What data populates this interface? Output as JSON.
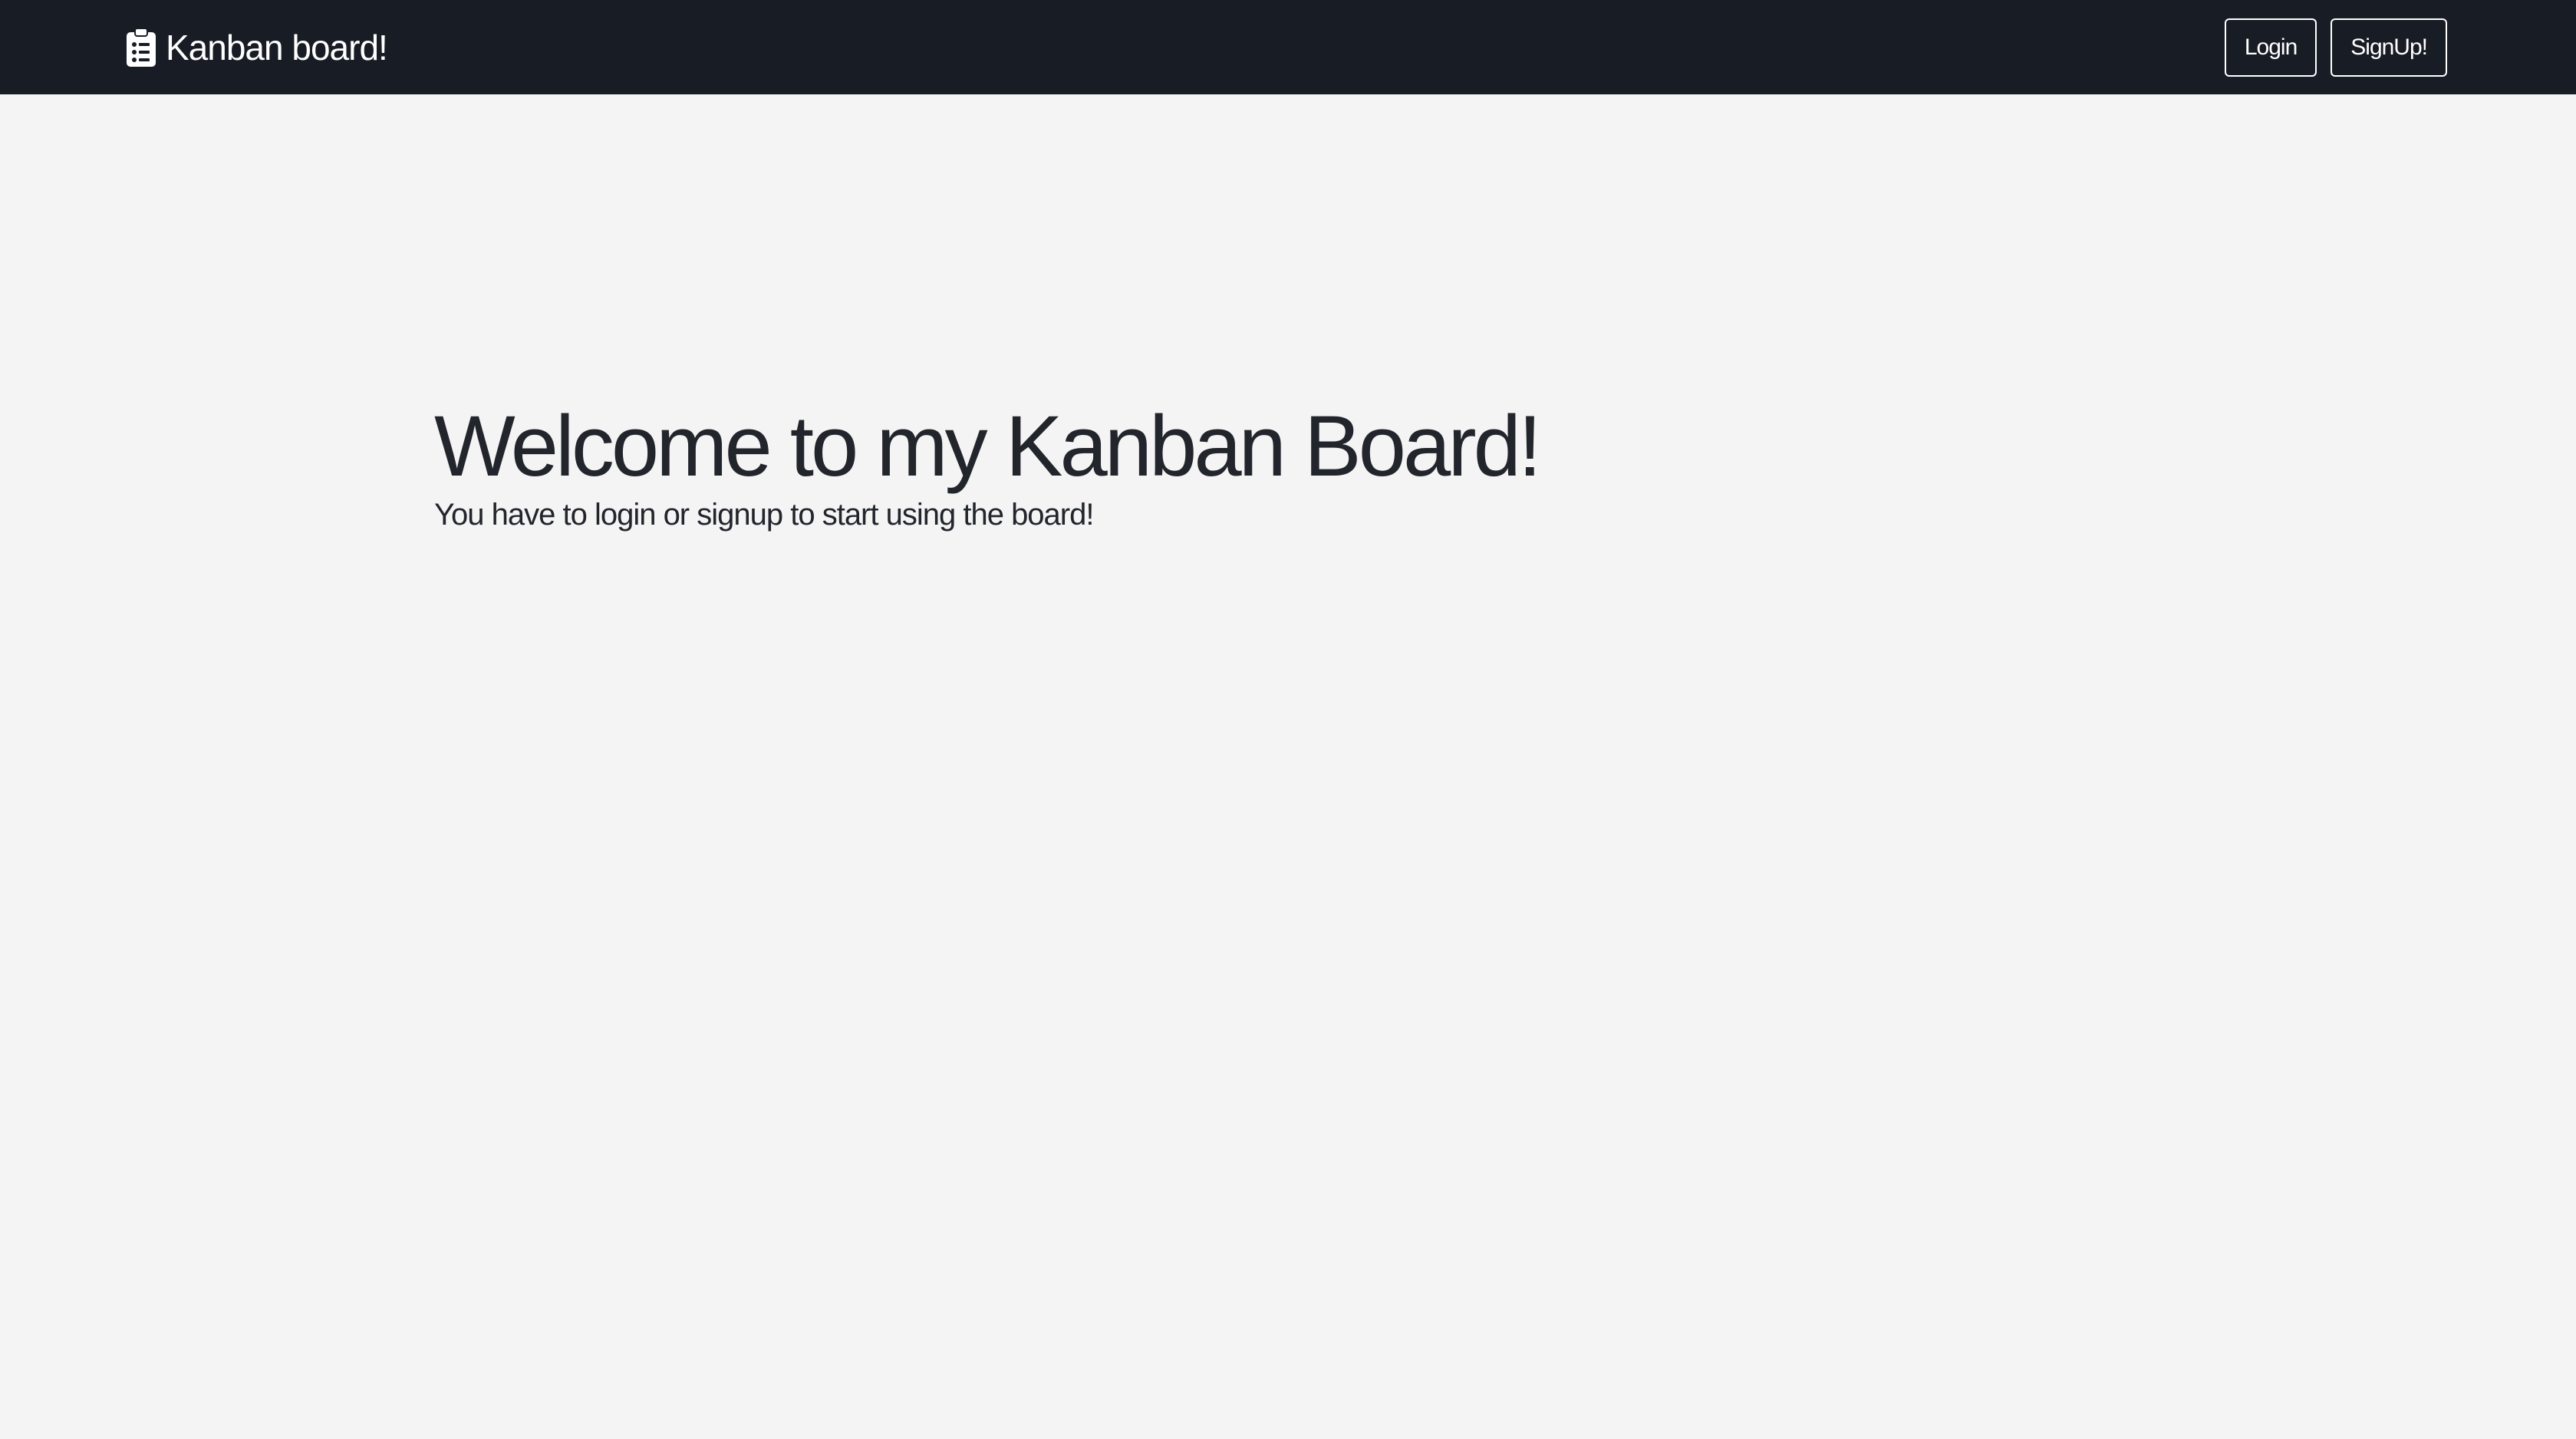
{
  "navbar": {
    "brand": {
      "icon": "clipboard-list-icon",
      "label": "Kanban board!"
    },
    "buttons": {
      "login_label": "Login",
      "signup_label": "SignUp!"
    }
  },
  "hero": {
    "title": "Welcome to my Kanban Board!",
    "subtitle": "You have to login or signup to start using the board!"
  },
  "colors": {
    "navbar_bg": "#181c24",
    "page_bg": "#f4f4f4",
    "text_dark": "#22252b",
    "text_light": "#ffffff"
  }
}
